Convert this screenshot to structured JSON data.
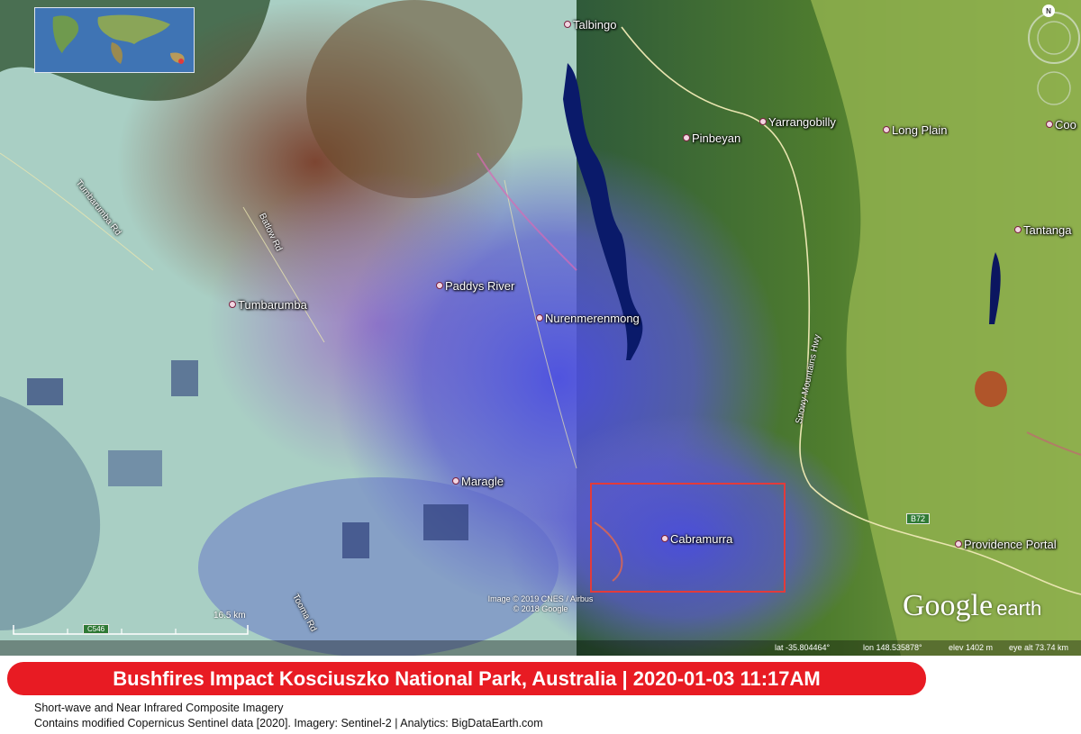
{
  "map": {
    "places": [
      {
        "id": "talbingo",
        "name": "Talbingo"
      },
      {
        "id": "yarrangobilly",
        "name": "Yarrangobilly"
      },
      {
        "id": "pinbeyan",
        "name": "Pinbeyan"
      },
      {
        "id": "long-plain",
        "name": "Long Plain"
      },
      {
        "id": "coo",
        "name": "Coo"
      },
      {
        "id": "tantanga",
        "name": "Tantanga"
      },
      {
        "id": "paddys-river",
        "name": "Paddys River"
      },
      {
        "id": "tumbarumba",
        "name": "Tumbarumba"
      },
      {
        "id": "nurenmerenmong",
        "name": "Nurenmerenmong"
      },
      {
        "id": "maragle",
        "name": "Maragle"
      },
      {
        "id": "cabramurra",
        "name": "Cabramurra"
      },
      {
        "id": "providence-portal",
        "name": "Providence Portal"
      }
    ],
    "roads": [
      {
        "id": "tumbarumba-rd",
        "name": "Tumbarumba Rd"
      },
      {
        "id": "batlow-rd",
        "name": "Batlow Rd"
      },
      {
        "id": "snowy-mountains-hwy",
        "name": "Snowy Mountains Hwy"
      },
      {
        "id": "tooma-rd",
        "name": "Tooma Rd"
      }
    ],
    "road_shields": {
      "c546": "C546",
      "b72": "B72"
    },
    "scale_label": "16.5 km",
    "compass_label": "N",
    "attribution": [
      "Image © 2019 CNES / Airbus",
      "© 2018 Google"
    ],
    "logo": {
      "google": "Google",
      "earth": "earth"
    },
    "status": {
      "lat": "lat  -35.804464°",
      "lon": "lon  148.535878°",
      "elev": "elev  1402 m",
      "eye_alt": "eye alt  73.74 km"
    },
    "highlight_color": "#e23b3b"
  },
  "banner": {
    "title": "Bushfires Impact Kosciuszko National Park, Australia | 2020-01-03 11:17AM",
    "color": "#e81b23"
  },
  "captions": {
    "line1": "Short-wave and Near Infrared Composite Imagery",
    "line2": "Contains modified Copernicus Sentinel data [2020]. Imagery: Sentinel-2 | Analytics: BigDataEarth.com"
  }
}
